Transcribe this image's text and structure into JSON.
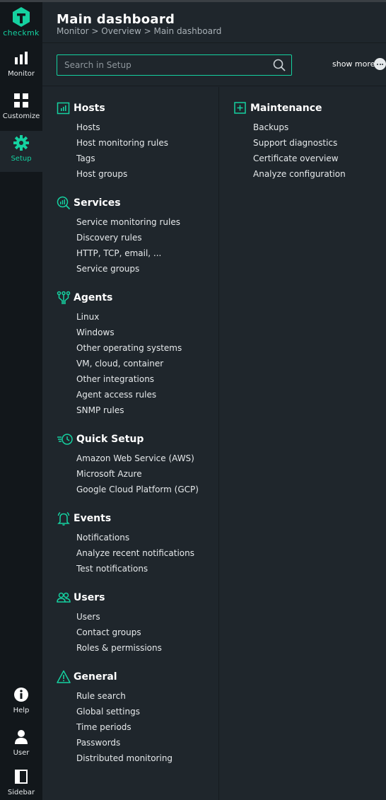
{
  "nav": {
    "logo_text": "checkmk",
    "items": [
      {
        "label": "Monitor",
        "icon": "bar-chart-icon"
      },
      {
        "label": "Customize",
        "icon": "grid-icon"
      },
      {
        "label": "Setup",
        "icon": "gear-icon",
        "active": true
      }
    ],
    "bottom": [
      {
        "label": "Help",
        "icon": "info-icon"
      },
      {
        "label": "User",
        "icon": "user-icon"
      },
      {
        "label": "Sidebar",
        "icon": "sidebar-icon"
      }
    ]
  },
  "header": {
    "title": "Main dashboard",
    "breadcrumb": "Monitor > Overview > Main dashboard"
  },
  "search": {
    "placeholder": "Search in Setup",
    "show_more": "show more"
  },
  "colors": {
    "accent": "#15d1a0",
    "background": "#1f262c",
    "nav_background": "#12171b"
  },
  "sections": {
    "hosts": {
      "title": "Hosts",
      "icon": "hosts-icon",
      "items": [
        "Hosts",
        "Host monitoring rules",
        "Tags",
        "Host groups"
      ]
    },
    "services": {
      "title": "Services",
      "icon": "services-icon",
      "items": [
        "Service monitoring rules",
        "Discovery rules",
        "HTTP, TCP, email, ...",
        "Service groups"
      ]
    },
    "agents": {
      "title": "Agents",
      "icon": "agents-icon",
      "items": [
        "Linux",
        "Windows",
        "Other operating systems",
        "VM, cloud, container",
        "Other integrations",
        "Agent access rules",
        "SNMP rules"
      ]
    },
    "quick_setup": {
      "title": "Quick Setup",
      "icon": "quick-setup-icon",
      "items": [
        "Amazon Web Service (AWS)",
        "Microsoft Azure",
        "Google Cloud Platform (GCP)"
      ]
    },
    "events": {
      "title": "Events",
      "icon": "bell-icon",
      "items": [
        "Notifications",
        "Analyze recent notifications",
        "Test notifications"
      ]
    },
    "users": {
      "title": "Users",
      "icon": "users-icon",
      "items": [
        "Users",
        "Contact groups",
        "Roles & permissions"
      ]
    },
    "general": {
      "title": "General",
      "icon": "warning-icon",
      "items": [
        "Rule search",
        "Global settings",
        "Time periods",
        "Passwords",
        "Distributed monitoring"
      ]
    },
    "maintenance": {
      "title": "Maintenance",
      "icon": "plus-box-icon",
      "items": [
        "Backups",
        "Support diagnostics",
        "Certificate overview",
        "Analyze configuration"
      ]
    }
  }
}
